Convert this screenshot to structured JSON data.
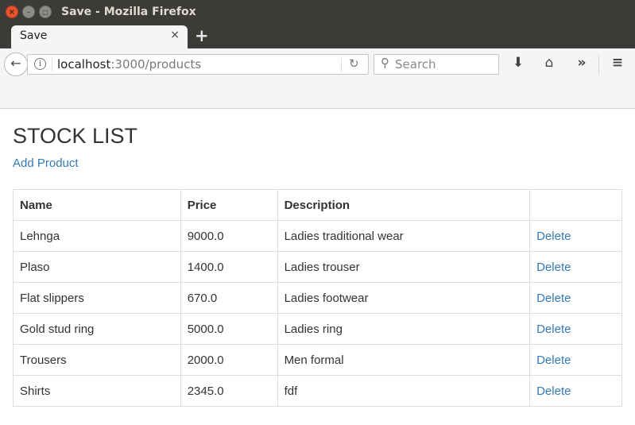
{
  "window": {
    "title": "Save - Mozilla Firefox",
    "close_glyph": "×",
    "min_glyph": "–",
    "max_glyph": "□"
  },
  "tabs": [
    {
      "label": "Save",
      "close_glyph": "×"
    }
  ],
  "new_tab_glyph": "+",
  "navbar": {
    "back_icon": "back-arrow-icon",
    "back_glyph": "←",
    "info_glyph": "i",
    "url_host": "localhost",
    "url_rest": ":3000/products",
    "reload_glyph": "↻",
    "search_placeholder": "Search",
    "search_glyph": "⚲",
    "download_glyph": "⬇",
    "home_glyph": "⌂",
    "overflow_glyph": "»",
    "menu_glyph": "≡"
  },
  "page": {
    "heading": "STOCK LIST",
    "add_link": "Add Product"
  },
  "table": {
    "headers": [
      "Name",
      "Price",
      "Description",
      ""
    ],
    "rows": [
      {
        "name": "Lehnga",
        "price": "9000.0",
        "description": "Ladies traditional wear",
        "action": "Delete"
      },
      {
        "name": "Plaso",
        "price": "1400.0",
        "description": "Ladies trouser",
        "action": "Delete"
      },
      {
        "name": "Flat slippers",
        "price": "670.0",
        "description": "Ladies footwear",
        "action": "Delete"
      },
      {
        "name": "Gold stud ring",
        "price": "5000.0",
        "description": "Ladies ring",
        "action": "Delete"
      },
      {
        "name": "Trousers",
        "price": "2000.0",
        "description": "Men formal",
        "action": "Delete"
      },
      {
        "name": "Shirts",
        "price": "2345.0",
        "description": "fdf",
        "action": "Delete"
      }
    ]
  },
  "colors": {
    "link": "#337ab7",
    "titlebar": "#3c3b37",
    "close_button": "#e9542f"
  }
}
